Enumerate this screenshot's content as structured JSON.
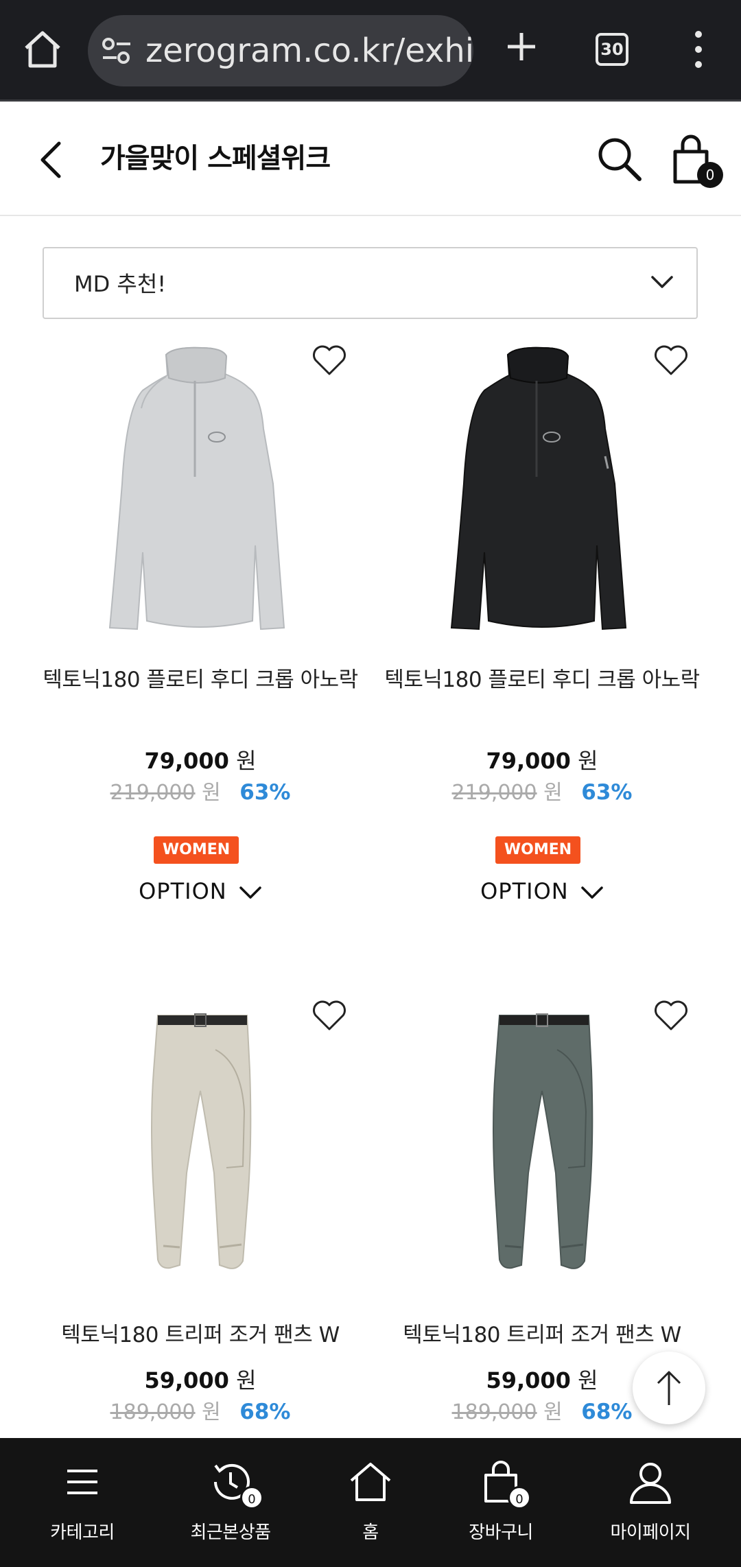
{
  "browser": {
    "url": "zerogram.co.kr/exhib",
    "tab_count": "30"
  },
  "header": {
    "title": "가을맞이 스페셜위크",
    "cart_count": "0"
  },
  "sort": {
    "selected": "MD 추천!"
  },
  "products": [
    {
      "name": "텍토닉180 플로티 후디 크롭 아노락",
      "price": "79,000",
      "currency": "원",
      "original_price": "219,000",
      "discount": "63%",
      "badge": "WOMEN",
      "option_label": "OPTION",
      "color": "light-gray"
    },
    {
      "name": "텍토닉180 플로티 후디 크롭 아노락",
      "price": "79,000",
      "currency": "원",
      "original_price": "219,000",
      "discount": "63%",
      "badge": "WOMEN",
      "option_label": "OPTION",
      "color": "black"
    },
    {
      "name": "텍토닉180 트리퍼 조거 팬츠 W",
      "price": "59,000",
      "currency": "원",
      "original_price": "189,000",
      "discount": "68%",
      "color": "beige"
    },
    {
      "name": "텍토닉180 트리퍼 조거 팬츠 W",
      "price": "59,000",
      "currency": "원",
      "original_price": "189,000",
      "discount": "68%",
      "color": "gray-green"
    }
  ],
  "bottom_nav": [
    {
      "label": "카테고리",
      "icon": "menu-icon"
    },
    {
      "label": "최근본상품",
      "icon": "history-icon",
      "badge": "0"
    },
    {
      "label": "홈",
      "icon": "home-icon"
    },
    {
      "label": "장바구니",
      "icon": "bag-icon",
      "badge": "0"
    },
    {
      "label": "마이페이지",
      "icon": "user-icon"
    }
  ],
  "colors": {
    "accent_discount": "#2e8ad8",
    "badge_women": "#f4511e",
    "nav_background": "#141414",
    "browser_background": "#1c1d21"
  }
}
